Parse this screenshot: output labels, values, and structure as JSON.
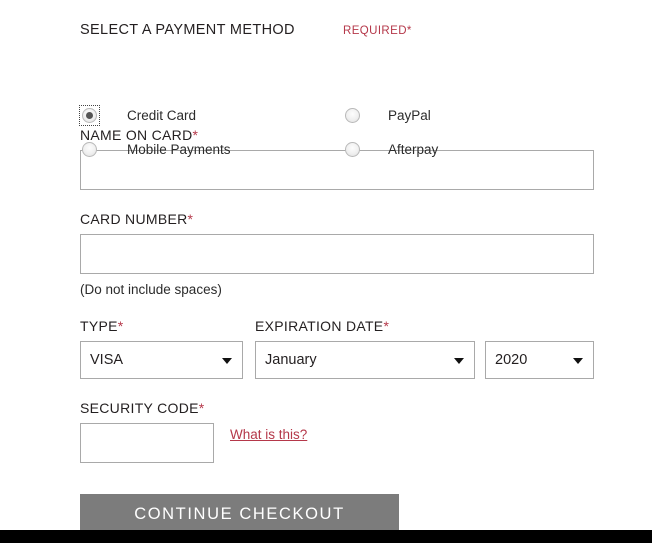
{
  "section": {
    "title": "SELECT A PAYMENT METHOD",
    "required_flag": "REQUIRED*"
  },
  "payment_methods": {
    "selected": "Credit Card",
    "options": [
      {
        "label": "Credit Card",
        "checked": true,
        "focused": true
      },
      {
        "label": "PayPal",
        "checked": false,
        "focused": false
      },
      {
        "label": "Mobile Payments",
        "checked": false,
        "focused": false
      },
      {
        "label": "Afterpay",
        "checked": false,
        "focused": false
      }
    ]
  },
  "fields": {
    "name_on_card": {
      "label": "NAME ON CARD",
      "required_mark": "*",
      "value": "",
      "placeholder": ""
    },
    "card_number": {
      "label": "CARD NUMBER",
      "required_mark": "*",
      "value": "",
      "placeholder": "",
      "hint": "(Do not include spaces)"
    },
    "card_type": {
      "label": "TYPE",
      "required_mark": "*",
      "value": "VISA"
    },
    "expiration_date": {
      "label": "EXPIRATION DATE",
      "required_mark": "*",
      "month_value": "January",
      "year_value": "2020"
    },
    "security_code": {
      "label": "SECURITY CODE",
      "required_mark": "*",
      "value": "",
      "placeholder": "",
      "help_link": "What is this?"
    }
  },
  "actions": {
    "submit_label": "Continue Checkout"
  },
  "colors": {
    "required_red": "#b5384a",
    "link_red": "#b5384a",
    "button_gray": "#7c7c7c",
    "input_border": "#a9a9a9",
    "text": "#231f20",
    "footer": "#000000"
  }
}
